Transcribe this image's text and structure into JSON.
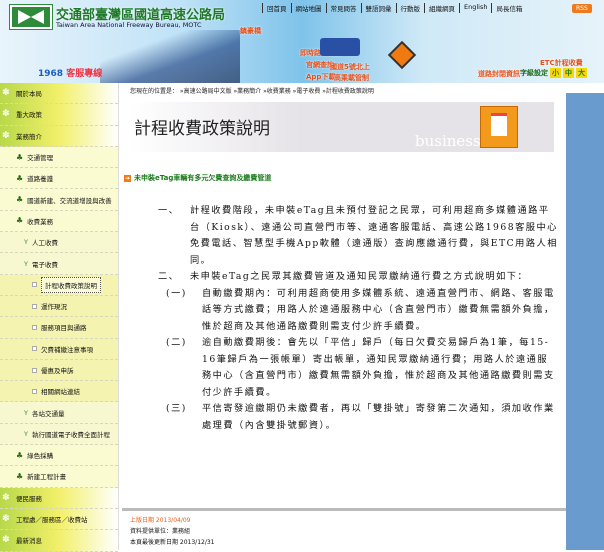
{
  "header": {
    "org_name": "交通部臺灣區國道高速公路局",
    "org_name_en": "Taiwan Area National Freeway Bureau, MOTC",
    "top_nav": [
      "回首頁",
      "網站地圖",
      "常見問答",
      "雙語詞彙",
      "行動版",
      "組織網頁",
      "English",
      "局長信箱"
    ],
    "rss": "RSS",
    "hotline_num": "1968",
    "hotline_label": "客服專線",
    "bridge_label": "鎮豪橋",
    "traffic_info": "即時路況資訊",
    "web_query": "官網查詢",
    "app_download": "App下載",
    "road_notice_1": "國道5號北上",
    "road_notice_2": "高乘載管制",
    "closure_info": "道路封閉資訊",
    "etc": "ETC計程收費",
    "font_size_label": "字級設定",
    "font_sizes": [
      "小",
      "中",
      "大"
    ]
  },
  "sidebar": {
    "items": [
      {
        "label": "關於本局",
        "level": 0
      },
      {
        "label": "重大政策",
        "level": 0
      },
      {
        "label": "業務簡介",
        "level": 0
      },
      {
        "label": "交通管理",
        "level": 1
      },
      {
        "label": "道路養護",
        "level": 1
      },
      {
        "label": "國道新建、交流道增設與改善",
        "level": 1
      },
      {
        "label": "收費業務",
        "level": 1
      },
      {
        "label": "人工收費",
        "level": 2
      },
      {
        "label": "電子收費",
        "level": 2
      },
      {
        "label": "計程收費政策說明",
        "level": 3,
        "selected": true
      },
      {
        "label": "運作現況",
        "level": 3
      },
      {
        "label": "服務項目與通路",
        "level": 3
      },
      {
        "label": "欠費補繳注意事項",
        "level": 3
      },
      {
        "label": "優惠及申訴",
        "level": 3
      },
      {
        "label": "相關網站連結",
        "level": 3
      },
      {
        "label": "各站交通量",
        "level": 2
      },
      {
        "label": "執行國道電子收費全面計程",
        "level": 2
      },
      {
        "label": "綠色採購",
        "level": 1
      },
      {
        "label": "新建工程計畫",
        "level": 1
      },
      {
        "label": "便民服務",
        "level": 0
      },
      {
        "label": "工程處／服務區／收費站",
        "level": 0
      },
      {
        "label": "最新消息",
        "level": 0
      }
    ]
  },
  "main": {
    "breadcrumb": "您現在的位置是：  »高速公路局中文版  »業務簡介  »收費業務  »電子收費  »計程收費政策說明",
    "title": "計程收費政策說明",
    "banner_word": "business",
    "notice_link": "未申裝eTag車輛有多元欠費查詢及繳費管道",
    "paragraphs": [
      {
        "num": "一、",
        "text": "計程收費階段，未申裝eTag且未預付登記之民眾，可利用超商多媒體通路平台（Kiosk）、遠通公司直營門市等、遠通客服電話、高速公路1968客服中心免費電話、智慧型手機App軟體（遠通版）查詢應繳通行費，與ETC用路人相同。"
      },
      {
        "num": "二、",
        "text": "未申裝eTag之民眾其繳費管道及通知民眾繳納通行費之方式說明如下："
      }
    ],
    "sub_paragraphs": [
      {
        "num": "(一)",
        "text": "自動繳費期內：可利用超商使用多媒體系統、遠通直營門市、網路、客服電話等方式繳費；用路人於遠通服務中心（含直營門市）繳費無需額外負擔，惟於超商及其他通路繳費則需支付少許手續費。"
      },
      {
        "num": "(二)",
        "text": "逾自動繳費期後：會先以「平信」歸戶（每日欠費交易歸戶為1筆，每15-16筆歸戶為一張帳單）寄出帳單，通知民眾繳納通行費；用路人於遠通服務中心（含直營門市）繳費無需額外負擔，惟於超商及其他通路繳費則需支付少許手續費。"
      },
      {
        "num": "(三)",
        "text": "平信寄發逾繳期仍未繳費者，再以「雙掛號」寄發第二次通知，須加收作業處理費（內含雙掛號郵資）。"
      }
    ],
    "footer": {
      "updated": "上版日期 2013/04/09",
      "provider": "資料提供單位：業務組",
      "last_modified": "本頁最後更新日期 2013/12/31"
    }
  },
  "colors": {
    "green": "#1a7a1a",
    "orange": "#e8601a",
    "strip": "#6a9bcf"
  }
}
